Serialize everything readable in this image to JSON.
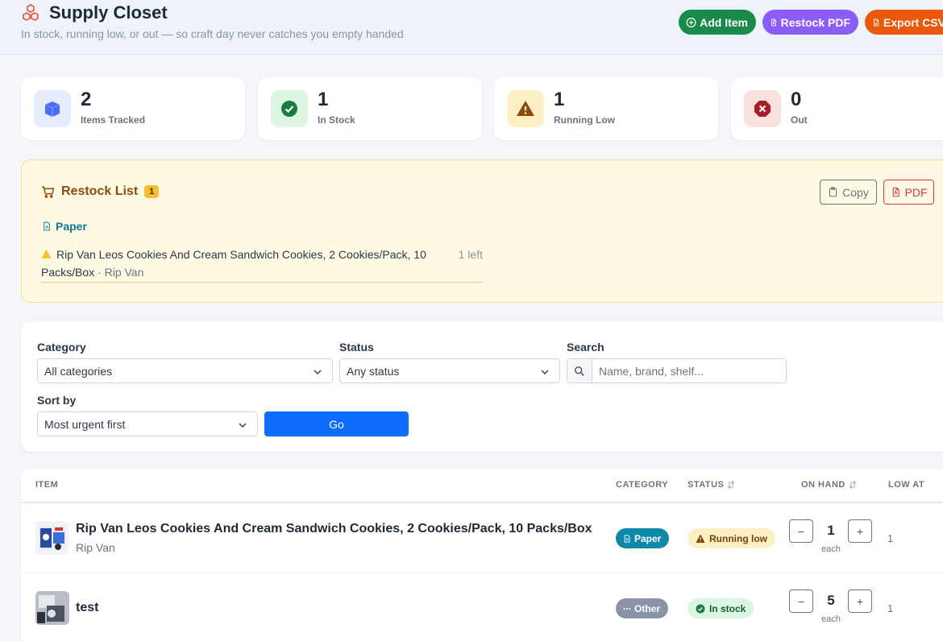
{
  "header": {
    "title": "Supply Closet",
    "subtitle": "In stock, running low, or out — so craft day never catches you empty handed",
    "buttons": {
      "add": "Add Item",
      "restock_pdf": "Restock PDF",
      "export_csv": "Export CSV"
    }
  },
  "stats": [
    {
      "value": "2",
      "label": "Items Tracked"
    },
    {
      "value": "1",
      "label": "In Stock"
    },
    {
      "value": "1",
      "label": "Running Low"
    },
    {
      "value": "0",
      "label": "Out"
    }
  ],
  "restock": {
    "title": "Restock List",
    "count": "1",
    "copy_label": "Copy",
    "pdf_label": "PDF",
    "category": "Paper",
    "items": [
      {
        "name": "Rip Van Leos Cookies And Cream Sandwich Cookies, 2 Cookies/Pack, 10 Packs/Box",
        "separator": " · ",
        "brand": "Rip Van",
        "remaining": "1 left"
      }
    ]
  },
  "filters": {
    "category_label": "Category",
    "category_value": "All categories",
    "status_label": "Status",
    "status_value": "Any status",
    "search_label": "Search",
    "search_placeholder": "Name, brand, shelf...",
    "sort_label": "Sort by",
    "sort_value": "Most urgent first",
    "go_label": "Go"
  },
  "table": {
    "columns": {
      "item": "ITEM",
      "category": "CATEGORY",
      "status": "STATUS",
      "on_hand": "ON HAND",
      "low_at": "LOW AT"
    },
    "rows": [
      {
        "name": "Rip Van Leos Cookies And Cream Sandwich Cookies, 2 Cookies/Pack, 10 Packs/Box",
        "brand": "Rip Van",
        "category": "Paper",
        "category_color": "#0e8aa8",
        "status": "Running low",
        "qty": "1",
        "unit": "each",
        "low_at": "1",
        "minus": "−",
        "plus": "+"
      },
      {
        "name": "test",
        "brand": "",
        "category": "Other",
        "category_color": "#8a94a6",
        "status": "In stock",
        "qty": "5",
        "unit": "each",
        "low_at": "1",
        "minus": "−",
        "plus": "+"
      }
    ]
  },
  "colors": {
    "add_button": "#1a8a4a",
    "pdf_button": "#8b5cf6",
    "csv_button": "#ea580c",
    "restock_bg": "#fef9e3",
    "go_button": "#0d6efd",
    "running_low_bg": "#fdf0c4",
    "in_stock_bg": "#dcf5e3"
  }
}
